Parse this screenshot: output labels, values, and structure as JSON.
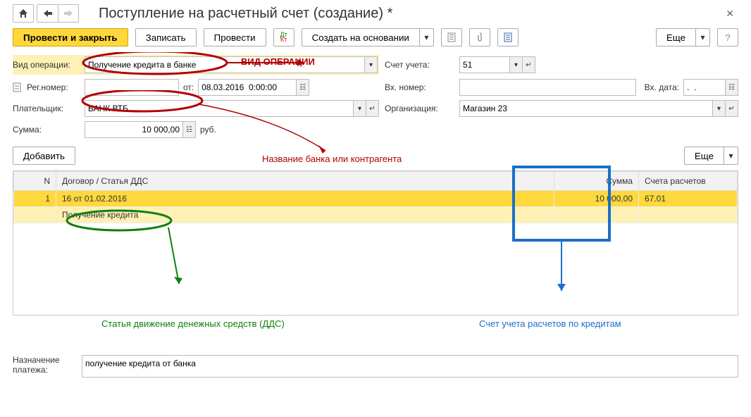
{
  "header": {
    "title": "Поступление на расчетный счет (создание) *"
  },
  "toolbar": {
    "post_and_close": "Провести и закрыть",
    "write": "Записать",
    "post": "Провести",
    "create_based": "Создать на основании",
    "more": "Еще"
  },
  "fields": {
    "operation_type_label": "Вид операции:",
    "operation_type_value": "Получение кредита в банке",
    "account_label": "Счет учета:",
    "account_value": "51",
    "reg_number_label": "Рег.номер:",
    "from_label": "от:",
    "date_value": "08.03.2016  0:00:00",
    "inc_number_label": "Вх. номер:",
    "inc_date_label": "Вх. дата:",
    "inc_date_value": ".  .",
    "payer_label": "Плательщик:",
    "payer_value": "БАНК ВТБ",
    "org_label": "Организация:",
    "org_value": "Магазин 23",
    "sum_label": "Сумма:",
    "sum_value": "10 000,00",
    "currency": "руб."
  },
  "table_toolbar": {
    "add": "Добавить",
    "more": "Еще"
  },
  "table": {
    "headers": {
      "n": "N",
      "contract": "Договор / Статья ДДС",
      "sum": "Сумма",
      "accounts": "Счета расчетов"
    },
    "rows": [
      {
        "n": "1",
        "contract": "16 от 01.02.2016",
        "sum": "10 000,00",
        "account": "67.01"
      }
    ],
    "subrow": {
      "contract": "Получение кредита"
    }
  },
  "bottom": {
    "purpose_label": "Назначение платежа:",
    "purpose_value": "получение кредита от банка"
  },
  "annotations": {
    "operation_type": "ВИД ОПЕРАЦИИ",
    "bank_name": "Название банка или контрагента",
    "dds": "Статья движение денежных средств (ДДС)",
    "credit_account": "Счет учета расчетов по кредитам"
  }
}
